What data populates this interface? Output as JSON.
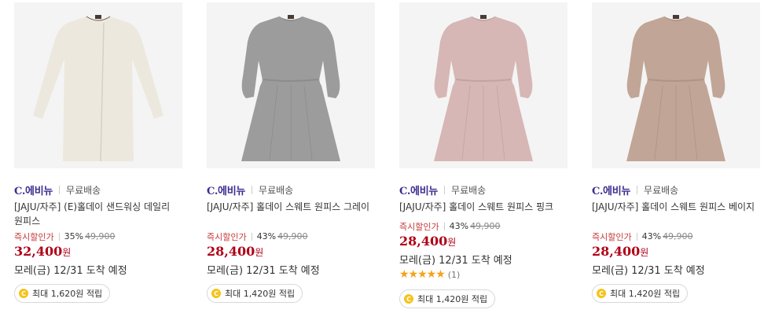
{
  "products": [
    {
      "brand": "C.에비뉴",
      "shipping": "무료배송",
      "name": "[JAJU/자주] (E)홀데이 샌드워싱 데일리 원피스",
      "sale_label": "즉시할인가",
      "discount": "35%",
      "original_price": "49,900",
      "price": "32,400",
      "price_unit": "원",
      "delivery": "모레(금) 12/31 도착 예정",
      "rating_count": "",
      "points": "최대 1,620원 적립",
      "dress_color": "#ede8de",
      "dress_style": "straight"
    },
    {
      "brand": "C.에비뉴",
      "shipping": "무료배송",
      "name": "[JAJU/자주] 홀데이 스웨트 원피스 그레이",
      "sale_label": "즉시할인가",
      "discount": "43%",
      "original_price": "49,900",
      "price": "28,400",
      "price_unit": "원",
      "delivery": "모레(금) 12/31 도착 예정",
      "rating_count": "",
      "points": "최대 1,420원 적립",
      "dress_color": "#9c9c9c",
      "dress_style": "gathered"
    },
    {
      "brand": "C.에비뉴",
      "shipping": "무료배송",
      "name": "[JAJU/자주] 홀데이 스웨트 원피스 핑크",
      "sale_label": "즉시할인가",
      "discount": "43%",
      "original_price": "49,900",
      "price": "28,400",
      "price_unit": "원",
      "delivery": "모레(금) 12/31 도착 예정",
      "rating_stars": 5,
      "rating_count": "(1)",
      "points": "최대 1,420원 적립",
      "dress_color": "#d6b7b5",
      "dress_style": "gathered"
    },
    {
      "brand": "C.에비뉴",
      "shipping": "무료배송",
      "name": "[JAJU/자주] 홀데이 스웨트 원피스 베이지",
      "sale_label": "즉시할인가",
      "discount": "43%",
      "original_price": "49,900",
      "price": "28,400",
      "price_unit": "원",
      "delivery": "모레(금) 12/31 도착 예정",
      "rating_count": "",
      "points": "최대 1,420원 적립",
      "dress_color": "#c1a597",
      "dress_style": "gathered"
    }
  ],
  "coin_icon": "coin-icon",
  "star_icon": "star-icon",
  "colors": {
    "brand": "#3b2e8f",
    "price": "#b00016",
    "sale_label": "#c53939",
    "star": "#f5a21b",
    "coin": "#f5c31b"
  }
}
